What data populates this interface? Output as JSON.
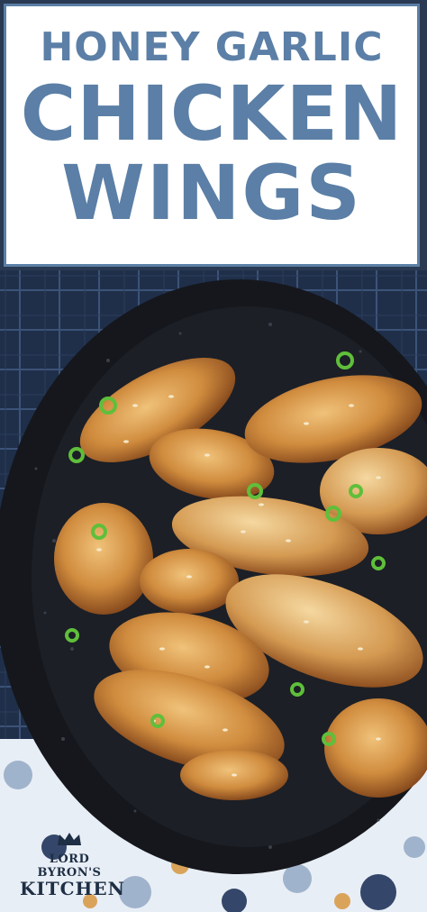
{
  "title": {
    "line1": "HONEY GARLIC",
    "line2": "CHICKEN",
    "line3": "WINGS"
  },
  "logo": {
    "line1": "LORD BYRON'S",
    "line2": "KITCHEN"
  },
  "colors": {
    "title": "#5b7fa6",
    "border": "#5b7fa6",
    "bowl": "#15171c",
    "cloth": "#1f2f4a",
    "glaze": "#c8863a"
  }
}
